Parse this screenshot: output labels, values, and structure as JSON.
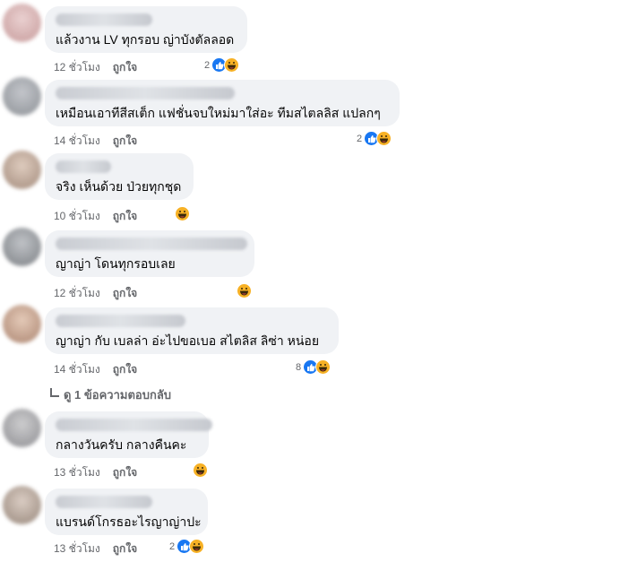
{
  "comments": [
    {
      "text": "แล้วงาน LV ทุกรอบ ญ่าบังตัลลอด",
      "time": "12 ชั่วโมง",
      "like": "ถูกใจ",
      "count": "2",
      "reactions": [
        "like-icon",
        "haha-icon"
      ]
    },
    {
      "text": "เหมือนเอาทีสีสเต็ก แฟชั่นจบใหม่มาใส่อะ ทีมสไตลลิส แปลกๆ",
      "time": "14 ชั่วโมง",
      "like": "ถูกใจ",
      "count": "2",
      "reactions": [
        "like-icon",
        "haha-icon"
      ]
    },
    {
      "text": "จริง เห็นด้วย ป่วยทุกชุด",
      "time": "10 ชั่วโมง",
      "like": "ถูกใจ",
      "count": "",
      "reactions": [
        "haha-icon"
      ]
    },
    {
      "text": "ญาญ่า โดนทุกรอบเลย",
      "time": "12 ชั่วโมง",
      "like": "ถูกใจ",
      "count": "",
      "reactions": [
        "haha-icon"
      ]
    },
    {
      "text": "ญาญ่า กับ เบลล่า อ่ะไปขอเบอ สไตลิส ลิซ่า หน่อย",
      "time": "14 ชั่วโมง",
      "like": "ถูกใจ",
      "count": "8",
      "reactions": [
        "like-icon",
        "haha-icon"
      ]
    },
    {
      "text": "กลางวันครับ กลางคืนคะ",
      "time": "13 ชั่วโมง",
      "like": "ถูกใจ",
      "count": "",
      "reactions": [
        "haha-icon"
      ]
    },
    {
      "text": "แบรนด์โกรธอะไรญาญ่าปะ",
      "time": "13 ชั่วโมง",
      "like": "ถูกใจ",
      "count": "2",
      "reactions": [
        "like-icon",
        "haha-icon"
      ]
    }
  ],
  "view_replies": "ดู 1 ข้อความตอบกลับ",
  "colors": {
    "like_blue": "#1877f2",
    "haha_yellow": "#f7b125",
    "bubble_bg": "#f0f2f5",
    "meta_gray": "#65676b"
  }
}
